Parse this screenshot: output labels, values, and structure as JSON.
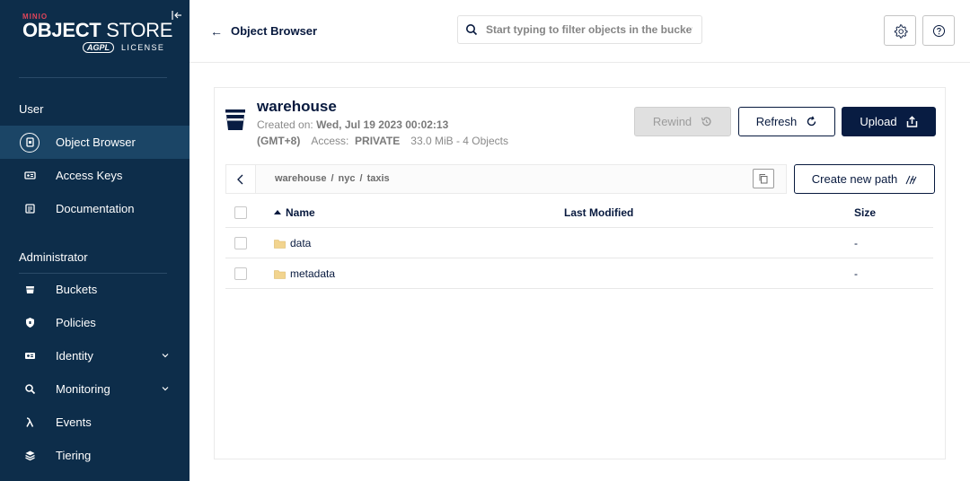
{
  "sidebar": {
    "logo": {
      "brand": "MINIO",
      "title_bold": "OBJECT",
      "title_rest": " STORE",
      "badge": "AGPL",
      "license": "LICENSE"
    },
    "section_user": "User",
    "section_admin": "Administrator",
    "items_user": [
      {
        "label": "Object Browser",
        "icon": "object-browser-icon",
        "active": true
      },
      {
        "label": "Access Keys",
        "icon": "access-keys-icon"
      },
      {
        "label": "Documentation",
        "icon": "documentation-icon"
      }
    ],
    "items_admin": [
      {
        "label": "Buckets",
        "icon": "buckets-icon"
      },
      {
        "label": "Policies",
        "icon": "policies-icon"
      },
      {
        "label": "Identity",
        "icon": "identity-icon",
        "expandable": true
      },
      {
        "label": "Monitoring",
        "icon": "monitoring-icon",
        "expandable": true
      },
      {
        "label": "Events",
        "icon": "events-icon"
      },
      {
        "label": "Tiering",
        "icon": "tiering-icon"
      }
    ]
  },
  "header": {
    "back_arrow": "←",
    "title": "Object Browser",
    "search_placeholder": "Start typing to filter objects in the bucket"
  },
  "bucket": {
    "name": "warehouse",
    "created_label": "Created on:",
    "created_value": "Wed, Jul 19 2023 00:02:13",
    "timezone": "(GMT+8)",
    "access_label": "Access:",
    "access_value": "PRIVATE",
    "usage": "33.0 MiB - 4 Objects"
  },
  "actions": {
    "rewind": "Rewind",
    "refresh": "Refresh",
    "upload": "Upload",
    "create_path": "Create new path"
  },
  "breadcrumb": {
    "crumbs": [
      "warehouse",
      "nyc",
      "taxis"
    ],
    "separator": "/"
  },
  "table": {
    "columns": {
      "name": "Name",
      "modified": "Last Modified",
      "size": "Size"
    },
    "rows": [
      {
        "name": "data",
        "modified": "",
        "size": "-"
      },
      {
        "name": "metadata",
        "modified": "",
        "size": "-"
      }
    ]
  },
  "colors": {
    "sidebar_bg": "#0d2d4a",
    "sidebar_active": "#1b4566",
    "primary": "#081c42",
    "brand_red": "#e0455a",
    "folder": "#f2d48e"
  }
}
